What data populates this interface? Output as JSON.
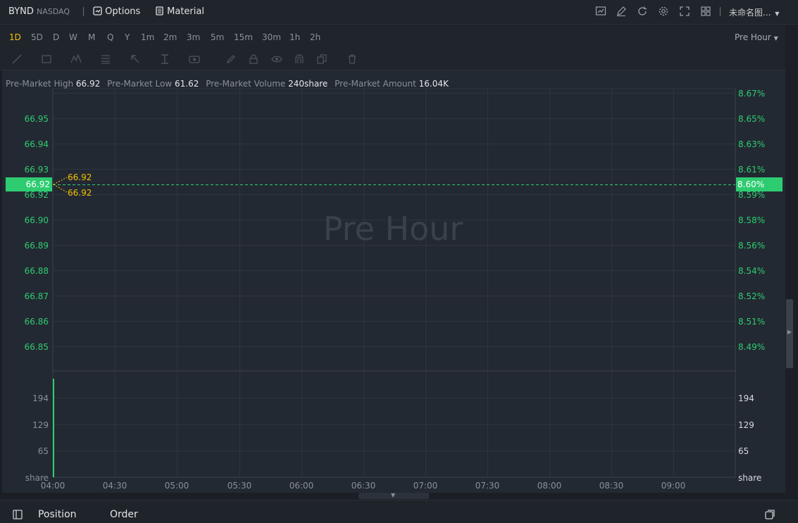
{
  "header": {
    "symbol": "BYND",
    "exchange": "NASDAQ",
    "options_label": "Options",
    "material_label": "Material",
    "layout_name": "未命名图...",
    "icons": [
      "chart-template-icon",
      "draw-edit-icon",
      "refresh-icon",
      "settings-gear-icon",
      "fullscreen-icon",
      "grid-layout-icon"
    ]
  },
  "intervals": {
    "items": [
      "1D",
      "5D",
      "D",
      "W",
      "M",
      "Q",
      "Y",
      "1m",
      "2m",
      "3m",
      "5m",
      "15m",
      "30m",
      "1h",
      "2h"
    ],
    "active": "1D",
    "session_label": "Pre Hour"
  },
  "drawing_tools": [
    "trend-line-icon",
    "rectangle-icon",
    "pattern-icon",
    "fib-icon",
    "arrow-icon",
    "measure-icon",
    "eye-annotation-icon",
    "pencil-icon",
    "lock-icon",
    "visibility-icon",
    "magnet-icon",
    "copy-icon",
    "trash-icon"
  ],
  "stats": {
    "high_label": "Pre-Market High",
    "high_value": "66.92",
    "low_label": "Pre-Market Low",
    "low_value": "61.62",
    "volume_label": "Pre-Market Volume",
    "volume_value": "240share",
    "amount_label": "Pre-Market Amount",
    "amount_value": "16.04K"
  },
  "watermark": "Pre Hour",
  "chart_data": {
    "type": "line",
    "price_axis_left": [
      "66.95",
      "66.94",
      "66.93",
      "66.92",
      "66.90",
      "66.89",
      "66.88",
      "66.87",
      "66.86",
      "66.85"
    ],
    "percent_axis_right": [
      "8.67%",
      "8.65%",
      "8.63%",
      "8.61%",
      "8.59%",
      "8.58%",
      "8.56%",
      "8.54%",
      "8.52%",
      "8.51%",
      "8.49%"
    ],
    "current_price": "66.92",
    "current_percent": "8.60%",
    "callout_high": "66.92",
    "callout_low": "66.92",
    "volume_axis": [
      "194",
      "129",
      "65",
      "share"
    ],
    "x_ticks": [
      "04:00",
      "04:30",
      "05:00",
      "05:30",
      "06:00",
      "06:30",
      "07:00",
      "07:30",
      "08:00",
      "08:30",
      "09:00"
    ],
    "volume_bars": [
      {
        "time": "04:00",
        "value": 240
      }
    ],
    "volume_max": 259,
    "colors": {
      "up": "#2ecc71",
      "price_tag_bg": "#2ecc71",
      "callout": "#f3c200",
      "grid": "#2e353e",
      "axis_text": "#2ecc71",
      "muted": "#8a9099"
    }
  },
  "bottom": {
    "position_label": "Position",
    "order_label": "Order"
  }
}
